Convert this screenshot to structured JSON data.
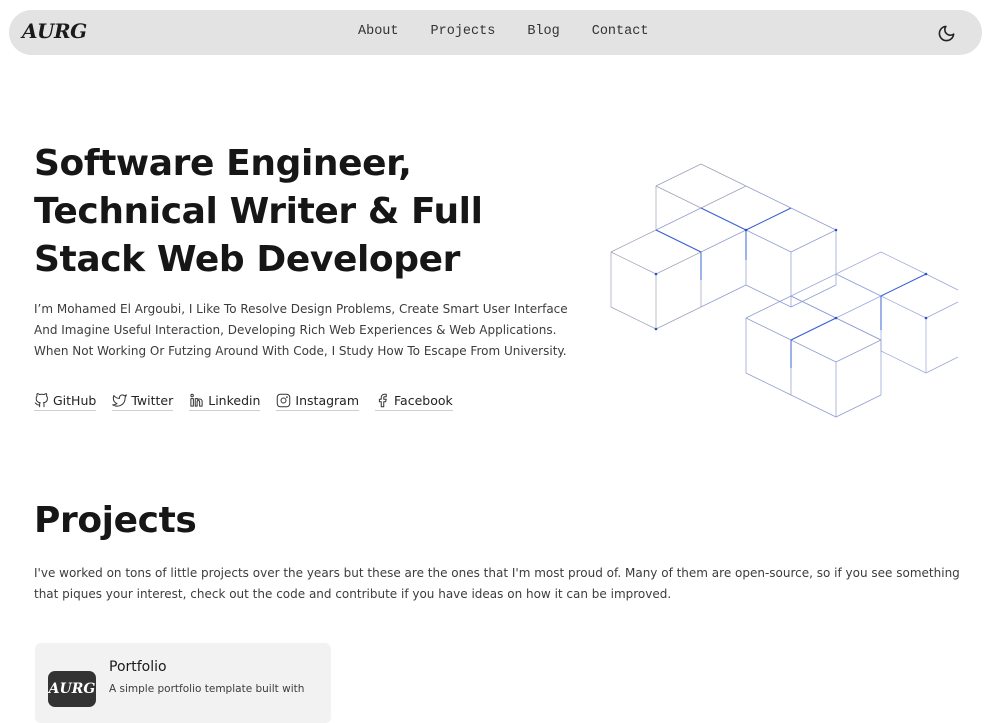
{
  "nav": {
    "logo": "AURG",
    "links": [
      "About",
      "Projects",
      "Blog",
      "Contact"
    ],
    "theme_icon": "moon-icon"
  },
  "hero": {
    "title": "Software Engineer, Technical Writer & Full Stack Web Developer",
    "description": "I’m Mohamed El Argoubi, I Like To Resolve Design Problems, Create Smart User Interface And Imagine Useful Interaction, Developing Rich Web Experiences & Web Applications. When Not Working Or Futzing Around With Code, I Study How To Escape From University.",
    "socials": [
      {
        "label": "GitHub",
        "icon": "github-icon"
      },
      {
        "label": "Twitter",
        "icon": "twitter-icon"
      },
      {
        "label": "Linkedin",
        "icon": "linkedin-icon"
      },
      {
        "label": "Instagram",
        "icon": "instagram-icon"
      },
      {
        "label": "Facebook",
        "icon": "facebook-icon"
      }
    ],
    "art_icon": "isometric-cubes-illustration"
  },
  "projects": {
    "title": "Projects",
    "description": "I've worked on tons of little projects over the years but these are the ones that I'm most proud of. Many of them are open-source, so if you see something that piques your interest, check out the code and contribute if you have ideas on how it can be improved.",
    "items": [
      {
        "logo": "AURG",
        "title": "Portfolio",
        "description": "A simple portfolio template built with"
      }
    ]
  },
  "colors": {
    "navbar_bg": "#e3e3e3",
    "card_bg": "#f2f2f2",
    "accent_line": "#3b63d6"
  }
}
